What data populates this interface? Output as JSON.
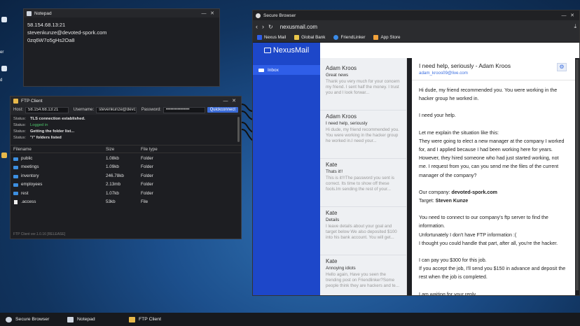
{
  "desktop": {
    "side_labels": [
      "er",
      "d"
    ]
  },
  "notepad": {
    "title": "Notepad",
    "lines": [
      "58.154.68.13:21",
      "stevenkunze@devoted-spork.com",
      "0zq6W7o5gHs2Oa8"
    ],
    "controls": [
      "—",
      "✕"
    ]
  },
  "ftp": {
    "title": "FTP Client",
    "host_label": "Host:",
    "host_value": "58.154.68.13:21",
    "username_label": "Username:",
    "username_value": "stevenkunze@devc",
    "password_label": "Password:",
    "password_value": "••••••••••••••••",
    "quickconnect_label": "Quickconnect",
    "log": [
      {
        "k": "Status:",
        "v": "TLS connection established.",
        "color": "white"
      },
      {
        "k": "Status:",
        "v": "Logged in",
        "color": "green"
      },
      {
        "k": "Status:",
        "v": "Getting the folder list...",
        "color": "white"
      },
      {
        "k": "Status:",
        "v": "\"/\" folders listed",
        "color": "white"
      }
    ],
    "columns": {
      "filename": "Filename",
      "size": "Size",
      "type": "File type"
    },
    "files": [
      {
        "name": "public",
        "size": "1.08kb",
        "type": "Folder"
      },
      {
        "name": "meetings",
        "size": "1.09kb",
        "type": "Folder"
      },
      {
        "name": "inventory",
        "size": "246.78kb",
        "type": "Folder"
      },
      {
        "name": "employees",
        "size": "2.13mb",
        "type": "Folder"
      },
      {
        "name": "rest",
        "size": "1.07kb",
        "type": "Folder"
      },
      {
        "name": ".access",
        "size": "53kb",
        "type": "File"
      }
    ],
    "footer": "FTP Client ver.1.0.16 [RELEASE]"
  },
  "browser": {
    "title": "Secure Browser",
    "url": "nexusmail.com",
    "bookmarks": [
      {
        "label": "Nexus Mail",
        "color": "#2f5ee8"
      },
      {
        "label": "Global Bank",
        "color": "#e9c64a"
      },
      {
        "label": "FriendLinker",
        "color": "#3a8be8"
      },
      {
        "label": "App Store",
        "color": "#f2a23b"
      }
    ]
  },
  "mail": {
    "brand": "NexusMail",
    "folder": "Inbox",
    "list": [
      {
        "from": "Adam Kroos",
        "subject": "Great news",
        "preview": "Thank you very much for your concern my friend. I sent half the money. I trust you and I look forwar..."
      },
      {
        "from": "Adam Kroos",
        "subject": "I need help, seriously",
        "preview": "Hi dude, my friend recommended you. You were working in the hacker group he worked in.I need your..."
      },
      {
        "from": "Kate",
        "subject": "Thats it!!",
        "preview": "This is it!!!The password you sent is correct. Its time to show off these fools.Im sending the rest of your..."
      },
      {
        "from": "Kate",
        "subject": "Details",
        "preview": "I leave details about your goal and target below We also deposited $100 into his bank account. You will get..."
      },
      {
        "from": "Kate",
        "subject": "Annoying idiots",
        "preview": "Hello again, Have you seen the trending post on Friendlinker?Some people think they are hackers and te..."
      }
    ],
    "open": {
      "subject": "I need help, seriously - Adam Kroos",
      "address": "adam_kroos09@live.com",
      "p1": "Hi dude, my friend recommended you. You were working in the hacker group he worked in.",
      "p2": "I need your help.",
      "p3": "Let me explain the situation like this:\nThey were going to elect a new manager at the company I worked for, and I applied because I had been working here for years. However, they hired someone who had just started working, not me. I request from you, can you send me the files of the current manager of the company?",
      "company_label": "Our company: ",
      "company_value": "devoted-spork.com",
      "target_label": "Target: ",
      "target_value": "Steven Kunze",
      "p4": "You need to connect to our company's ftp server to find the information.\nUnfortunately I don't have FTP information :(\nI thought you could handle that part, after all, you're the hacker.",
      "p5": "I can pay you $300 for this job.\nIf you accept the job, I'll send you $150 in advance and deposit the rest when the job is completed.",
      "p6": "I am waiting for your reply."
    }
  },
  "taskbar": {
    "items": [
      {
        "label": "Secure Browser",
        "color": "#cfd6e0"
      },
      {
        "label": "Notepad",
        "color": "#cfd6e0"
      },
      {
        "label": "FTP Client",
        "color": "#e7b84a"
      }
    ]
  }
}
